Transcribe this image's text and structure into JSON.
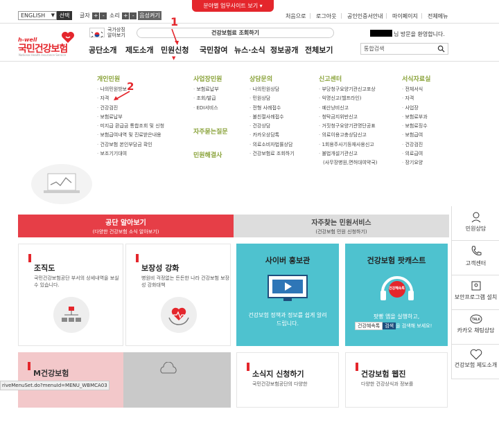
{
  "topbar": {
    "language": "ENGLISH",
    "language_button": "선택",
    "font_size_label": "글자",
    "volume_label": "소리",
    "plus": "+",
    "minus": "-",
    "voice_button": "음성켜기",
    "red_tab": "분야별 업무사이트 보기",
    "links": [
      "처음으로",
      "로그아웃",
      "공인인증서안내",
      "마이페이지",
      "전체메뉴"
    ]
  },
  "header": {
    "logo_en": "h-well",
    "logo_ko": "국민건강보험",
    "logo_sub": "National Health Insurance Service",
    "flag_text_1": "국가상징",
    "flag_text_2": "알아보기",
    "lookup": "건강보험료 조회하기",
    "welcome": "님 방문을 환영합니다.",
    "search_placeholder": "통합검색"
  },
  "nav": [
    "공단소개",
    "제도소개",
    "민원신청",
    "국민참여",
    "뉴스·소식",
    "정보공개",
    "전체보기"
  ],
  "annotations": {
    "step1": "1",
    "step2": "2"
  },
  "mega": {
    "col1": {
      "title": "개인민원",
      "items": [
        "나의민원방보",
        "자격",
        "건강검진",
        "보험료납부",
        "미지급 환급금 통합조회 및 신청",
        "보험급여내역 및 진료받은내용",
        "건강보험 본인부담금 확인",
        "보조기기대여"
      ]
    },
    "col2": {
      "title": "사업장민원",
      "items": [
        "보험료납부",
        "조회/발급",
        "EDI서비스"
      ],
      "title2": "자주묻는질문",
      "title3": "민원해결사"
    },
    "col3": {
      "title": "상담문의",
      "items": [
        "나의민원상담",
        "민원상담",
        "전형 사례접수",
        "불친절사례접수",
        "건강상담",
        "카카오상담톡",
        "의료소비자법률상담",
        "건강보험료 조회하기"
      ]
    },
    "col4": {
      "title": "신고센터",
      "items": [
        "부당청구요양기관신고포상",
        "익명신고(헬프라인)",
        "예산낭비신고",
        "청탁금지위반신고",
        "거짓청구요양기관명단공표",
        "의료이용고충상담신고",
        "1회용주사기등재사용신고",
        "불법개설기관신고"
      ],
      "extra": "(사무장병원,면허대여약국)"
    },
    "col5": {
      "title": "서식자료실",
      "items": [
        "전체서식",
        "자격",
        "사업장",
        "보험료부과",
        "보험료징수",
        "보험급여",
        "건강검진",
        "의료급여",
        "장기요양"
      ]
    }
  },
  "banners": {
    "left_title": "공단 알아보기",
    "left_sub": "(다양한 건강보험 소식 알아보기)",
    "right_title": "자주찾는 민원서비스",
    "right_sub": "(건강보험 민원 신청하기)"
  },
  "sidebar": [
    "민원상담",
    "고객센터",
    "보안프로그램 설치",
    "카카오 채팅상담",
    "건강보험 제도소개"
  ],
  "cards": {
    "org_title": "조직도",
    "org_desc": "국민건강보험공단 부서의 상세내역을 보실 수 있습니다.",
    "cov_title": "보장성 강화",
    "cov_desc": "병원비 걱정없는 든든한 나라 건강보험 보장성 강화대책",
    "cyber_title": "사이버 홍보관",
    "cyber_desc": "건강보험 정책과 정보를 쉽게 알려드립니다.",
    "podcast_title": "건강보험 팟캐스트",
    "podcast_desc_1": "팟빵 앱을 실행하고,",
    "podcast_search": "건강혜속톡",
    "podcast_search_btn": "검색",
    "podcast_desc_2": "을 검색해 보세요!",
    "podcast_badge": "건강혜속톡",
    "mhealth_title": "M건강보험",
    "news_title": "소식지 신청하기",
    "news_desc": "국민건강보험공단의 다양한",
    "webzine_title": "건강보험 웹진",
    "webzine_desc": "다양한 건강상식과 정보를"
  },
  "statusbar": "riveMenuSet.do?menuId=MENU_WBMCA03"
}
